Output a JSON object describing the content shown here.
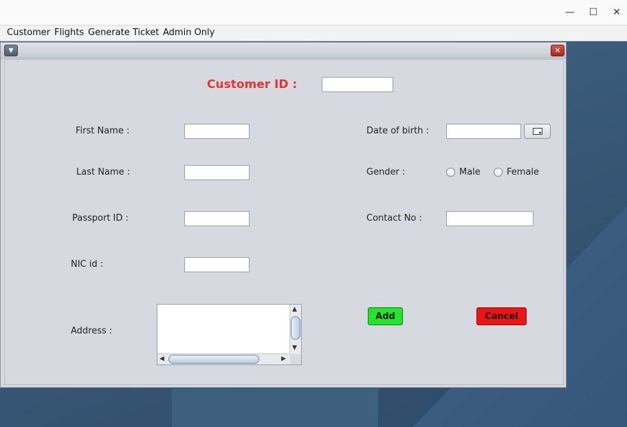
{
  "window": {
    "minimize_glyph": "—",
    "maximize_glyph": "☐",
    "close_glyph": "✕"
  },
  "menubar": {
    "items": [
      {
        "label": "Customer"
      },
      {
        "label": "Flights"
      },
      {
        "label": "Generate Ticket"
      },
      {
        "label": "Admin Only"
      }
    ]
  },
  "internal_frame": {
    "menu_icon": "chevron-down-icon",
    "close_icon": "close-icon"
  },
  "form": {
    "customer_id_label": "Customer ID :",
    "customer_id_value": "",
    "first_name_label": "First Name :",
    "first_name_value": "",
    "last_name_label": "Last Name :",
    "last_name_value": "",
    "passport_label": "Passport ID :",
    "passport_value": "",
    "nic_label": "NIC id :",
    "nic_value": "",
    "address_label": "Address :",
    "address_value": "",
    "dob_label": "Date of birth :",
    "dob_value": "",
    "gender_label": "Gender :",
    "gender_options": [
      "Male",
      "Female"
    ],
    "contact_label": "Contact No :",
    "contact_value": ""
  },
  "buttons": {
    "add_label": "Add",
    "cancel_label": "Cancel",
    "add_color": "#22e62a",
    "cancel_color": "#ef1414"
  },
  "colors": {
    "customer_id_accent": "#e8342e",
    "panel_bg": "#d6d9df"
  }
}
